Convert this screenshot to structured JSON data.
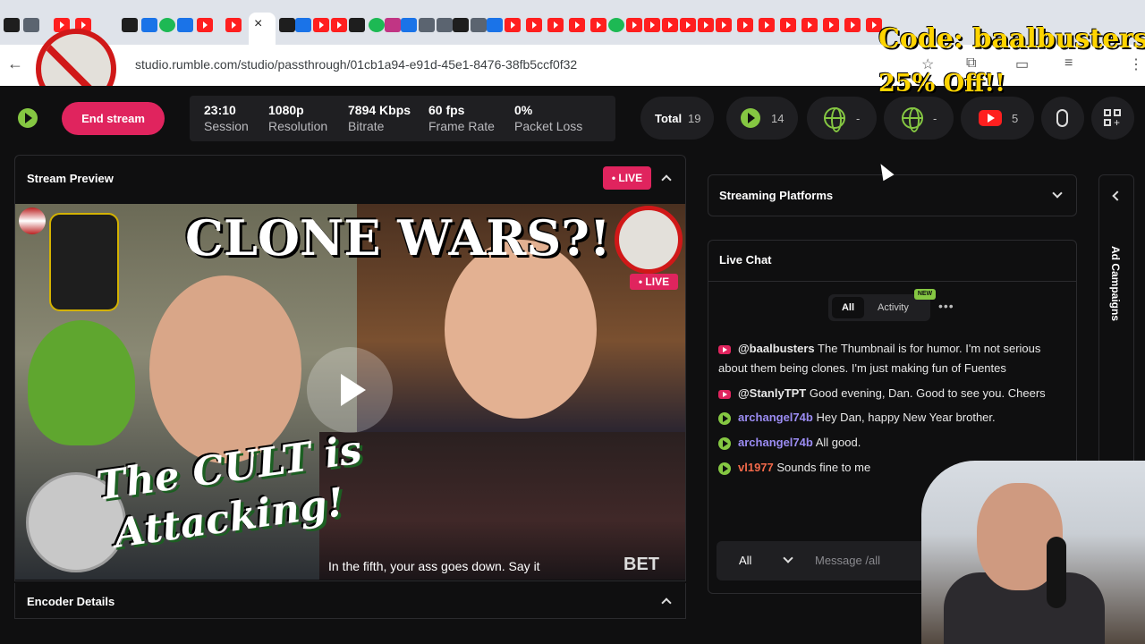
{
  "browser": {
    "url": "studio.rumble.com/studio/passthrough/01cb1a94-e91d-45e1-8476-38fb5ccf0f32",
    "active_tab_close": "×"
  },
  "overlay": {
    "promo_line1": "Code: baalbusters",
    "promo_line2": "25% Off!!"
  },
  "header": {
    "end_stream_label": "End stream",
    "stats": [
      {
        "value": "23:10",
        "label": "Session"
      },
      {
        "value": "1080p",
        "label": "Resolution"
      },
      {
        "value": "7894 Kbps",
        "label": "Bitrate"
      },
      {
        "value": "60 fps",
        "label": "Frame Rate"
      },
      {
        "value": "0%",
        "label": "Packet Loss"
      }
    ],
    "total_label": "Total",
    "total_count": "19",
    "rumble_count": "14",
    "globe1_count": "-",
    "globe2_count": "-",
    "youtube_count": "5"
  },
  "preview": {
    "title": "Stream Preview",
    "live_badge": "• LIVE",
    "video": {
      "thumb_title": "CLONE WARS?!",
      "thumb_text1": "The CULT is",
      "thumb_text2": "Attacking!",
      "caption": "In the fifth, your ass goes down. Say it",
      "live_tag": "• LIVE",
      "beta_text": "BET"
    }
  },
  "encoder": {
    "title": "Encoder Details"
  },
  "platforms": {
    "title": "Streaming Platforms"
  },
  "chat": {
    "title": "Live Chat",
    "tabs": {
      "all": "All",
      "activity": "Activity",
      "new_badge": "NEW",
      "more": "•••"
    },
    "messages": [
      {
        "source": "youtube",
        "user": "@baalbusters",
        "user_color": "#ffffff",
        "text": "The Thumbnail is for humor. I'm not serious about them being clones. I'm just making fun of Fuentes"
      },
      {
        "source": "youtube",
        "user": "@StanlyTPT",
        "user_color": "#ffffff",
        "text": "Good evening, Dan. Good to see you. Cheers"
      },
      {
        "source": "rumble",
        "user": "archangel74b",
        "user_color": "#9b8cf2",
        "text": "Hey Dan, happy New Year brother."
      },
      {
        "source": "rumble",
        "user": "archangel74b",
        "user_color": "#9b8cf2",
        "text": "All good."
      },
      {
        "source": "rumble",
        "user": "vl1977",
        "user_color": "#f2694a",
        "text": "Sounds fine to me"
      }
    ],
    "input": {
      "target": "All",
      "placeholder": "Message /all"
    }
  },
  "right_rail": {
    "label": "Ad Campaigns"
  },
  "colors": {
    "accent_green": "#85c742",
    "live_pink": "#e0245e",
    "panel_bg": "#1f1f22",
    "page_bg": "#0f0f10"
  }
}
